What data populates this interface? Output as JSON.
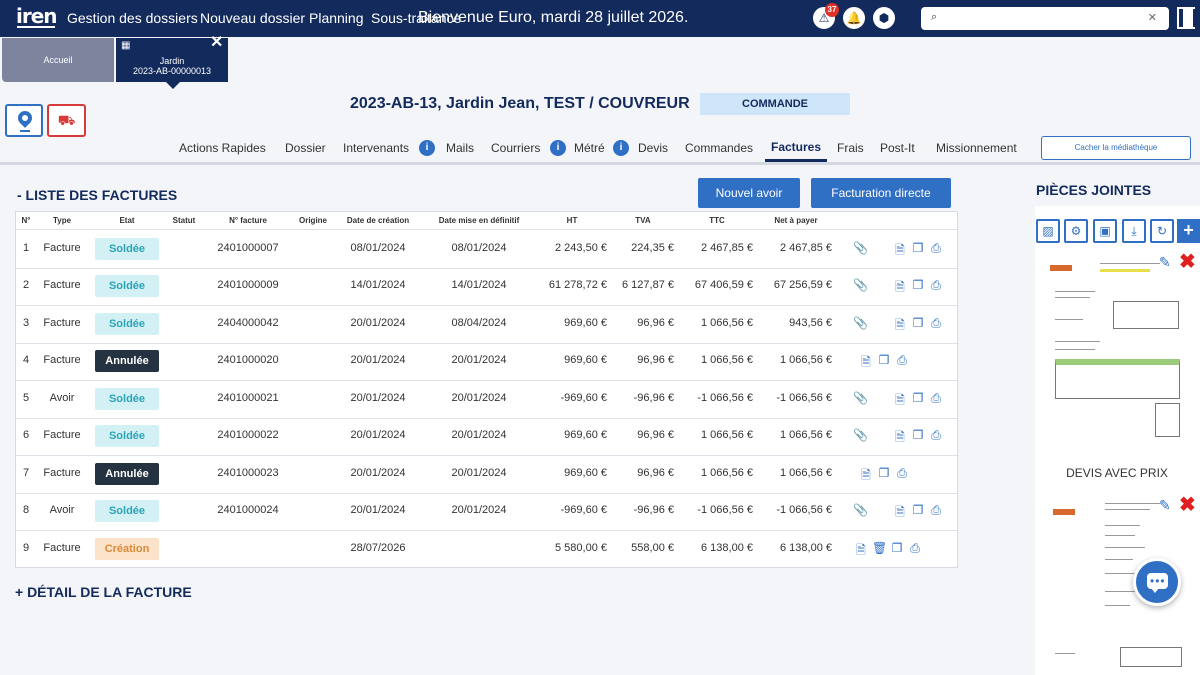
{
  "topbar": {
    "logo": "iren",
    "nav": [
      "Gestion des dossiers",
      "Nouveau dossier",
      "Planning",
      "Sous-traitance"
    ],
    "welcome": "Bienvenue Euro, mardi 28 juillet 2026.",
    "alert_count": "37",
    "search_value": ""
  },
  "tabs": {
    "home": "Accueil",
    "active_line1": "Jardin",
    "active_line2": "2023-AB-00000013"
  },
  "dossier": {
    "title": "2023-AB-13, Jardin Jean, TEST / COUVREUR",
    "status": "COMMANDE"
  },
  "subnav": {
    "items": [
      "Actions Rapides",
      "Dossier",
      "Intervenants",
      "Mails",
      "Courriers",
      "Métré",
      "Devis",
      "Commandes",
      "Factures",
      "Frais",
      "Post-It",
      "Missionnement"
    ],
    "active": "Factures",
    "media_button": "Cacher la médiathèque"
  },
  "factures": {
    "title": "- LISTE DES FACTURES",
    "new_avoir": "Nouvel avoir",
    "direct_billing": "Facturation directe",
    "columns": [
      "N°",
      "Type",
      "Etat",
      "Statut",
      "N° facture",
      "Origine",
      "Date de création",
      "Date mise en définitif",
      "HT",
      "TVA",
      "TTC",
      "Net à payer"
    ],
    "rows": [
      {
        "n": "1",
        "type": "Facture",
        "etat": "Soldée",
        "statut": "",
        "num": "2401000007",
        "origine": "",
        "creation": "08/01/2024",
        "definitif": "08/01/2024",
        "ht": "2 243,50 €",
        "tva": "224,35 €",
        "ttc": "2 467,85 €",
        "net": "2 467,85 €",
        "attach": true,
        "trash": false
      },
      {
        "n": "2",
        "type": "Facture",
        "etat": "Soldée",
        "statut": "",
        "num": "2401000009",
        "origine": "",
        "creation": "14/01/2024",
        "definitif": "14/01/2024",
        "ht": "61 278,72 €",
        "tva": "6 127,87 €",
        "ttc": "67 406,59 €",
        "net": "67 256,59 €",
        "attach": true,
        "trash": false
      },
      {
        "n": "3",
        "type": "Facture",
        "etat": "Soldée",
        "statut": "",
        "num": "2404000042",
        "origine": "",
        "creation": "20/01/2024",
        "definitif": "08/04/2024",
        "ht": "969,60 €",
        "tva": "96,96 €",
        "ttc": "1 066,56 €",
        "net": "943,56 €",
        "attach": true,
        "trash": false
      },
      {
        "n": "4",
        "type": "Facture",
        "etat": "Annulée",
        "statut": "",
        "num": "2401000020",
        "origine": "",
        "creation": "20/01/2024",
        "definitif": "20/01/2024",
        "ht": "969,60 €",
        "tva": "96,96 €",
        "ttc": "1 066,56 €",
        "net": "1 066,56 €",
        "attach": false,
        "trash": false
      },
      {
        "n": "5",
        "type": "Avoir",
        "etat": "Soldée",
        "statut": "",
        "num": "2401000021",
        "origine": "",
        "creation": "20/01/2024",
        "definitif": "20/01/2024",
        "ht": "-969,60 €",
        "tva": "-96,96 €",
        "ttc": "-1 066,56 €",
        "net": "-1 066,56 €",
        "attach": true,
        "trash": false
      },
      {
        "n": "6",
        "type": "Facture",
        "etat": "Soldée",
        "statut": "",
        "num": "2401000022",
        "origine": "",
        "creation": "20/01/2024",
        "definitif": "20/01/2024",
        "ht": "969,60 €",
        "tva": "96,96 €",
        "ttc": "1 066,56 €",
        "net": "1 066,56 €",
        "attach": true,
        "trash": false
      },
      {
        "n": "7",
        "type": "Facture",
        "etat": "Annulée",
        "statut": "",
        "num": "2401000023",
        "origine": "",
        "creation": "20/01/2024",
        "definitif": "20/01/2024",
        "ht": "969,60 €",
        "tva": "96,96 €",
        "ttc": "1 066,56 €",
        "net": "1 066,56 €",
        "attach": false,
        "trash": false
      },
      {
        "n": "8",
        "type": "Avoir",
        "etat": "Soldée",
        "statut": "",
        "num": "2401000024",
        "origine": "",
        "creation": "20/01/2024",
        "definitif": "20/01/2024",
        "ht": "-969,60 €",
        "tva": "-96,96 €",
        "ttc": "-1 066,56 €",
        "net": "-1 066,56 €",
        "attach": true,
        "trash": false
      },
      {
        "n": "9",
        "type": "Facture",
        "etat": "Création",
        "statut": "",
        "num": "",
        "origine": "",
        "creation": "28/07/2026",
        "definitif": "",
        "ht": "5 580,00 €",
        "tva": "558,00 €",
        "ttc": "6 138,00 €",
        "net": "6 138,00 €",
        "attach": false,
        "trash": true
      }
    ]
  },
  "detail": {
    "title": "+ DÉTAIL DE LA FACTURE"
  },
  "pieces": {
    "title": "PIÈCES JOINTES",
    "doc1_label": "DEVIS AVEC PRIX"
  },
  "colors": {
    "primary": "#132a5c",
    "accent": "#2f6fc4",
    "danger": "#e02020"
  }
}
